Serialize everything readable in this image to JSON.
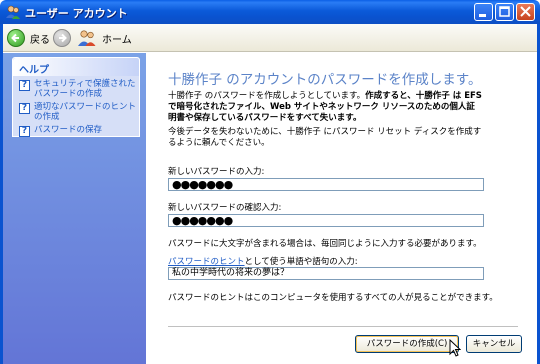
{
  "window": {
    "title": "ユーザー アカウント"
  },
  "toolbar": {
    "back_label": "戻る",
    "home_label": "ホーム"
  },
  "sidebar": {
    "help_title": "ヘルプ",
    "links": [
      {
        "label": "セキュリティで保護されたパスワードの作成"
      },
      {
        "label": "適切なパスワードのヒントの作成"
      },
      {
        "label": "パスワードの保存"
      }
    ]
  },
  "main": {
    "heading": "十勝作子 のアカウントのパスワードを作成します。",
    "warning_plain": "十勝作子 のパスワードを作成しようとしています。",
    "warning_bold": "作成すると、十勝作子 は EFS で暗号化されたファイル、Web サイトやネットワーク リソースのための個人証明書や保存しているパスワードをすべて失います。",
    "reset_disk_note": "今後データを失わないために、十勝作子 にパスワード リセット ディスクを作成するように頼んでください。",
    "new_password_label": "新しいパスワードの入力:",
    "new_password_value": "●●●●●●●",
    "confirm_password_label": "新しいパスワードの確認入力:",
    "confirm_password_value": "●●●●●●●",
    "case_note": "パスワードに大文字が含まれる場合は、毎回同じように入力する必要があります。",
    "hint_link": "パスワードのヒント",
    "hint_label_rest": "として使う単語や語句の入力:",
    "hint_value": "私の中学時代の将来の夢は？",
    "hint_note": "パスワードのヒントはこのコンピュータを使用するすべての人が見ることができます。",
    "create_button": "パスワードの作成(C)",
    "cancel_button": "キャンセル"
  }
}
